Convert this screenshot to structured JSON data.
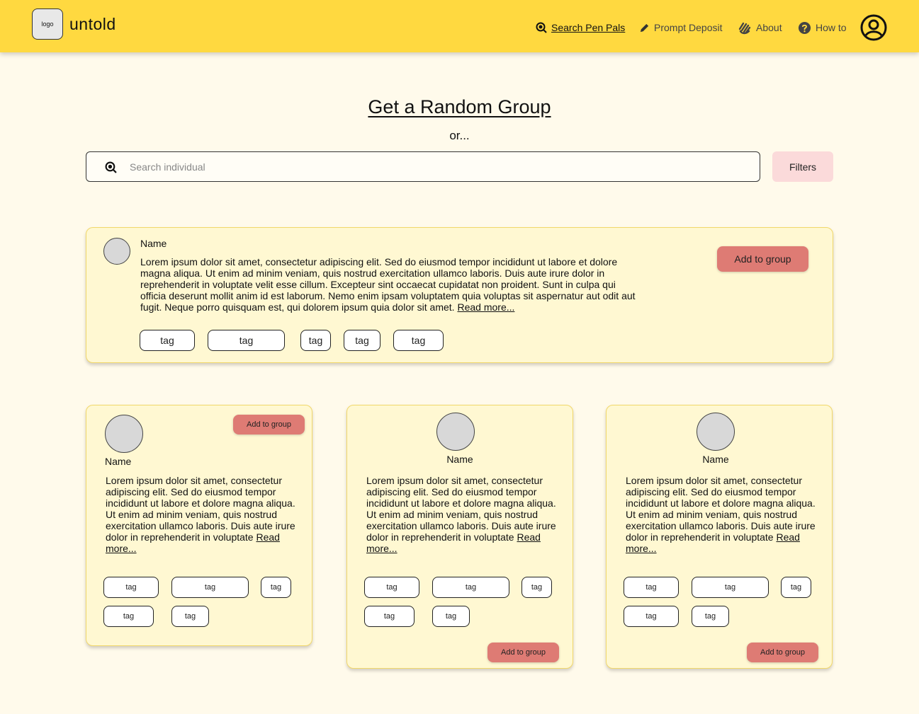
{
  "header": {
    "logo_text": "logo",
    "brand": "untold",
    "nav": [
      {
        "label": "Search Pen Pals",
        "icon": "search-icon"
      },
      {
        "label": "Prompt Deposit",
        "icon": "pencil-icon"
      },
      {
        "label": "About",
        "icon": "wave-hand-icon"
      },
      {
        "label": "How to",
        "icon": "help-circle-icon"
      }
    ]
  },
  "hero": {
    "title": "Get a Random Group",
    "or": "or...",
    "search_placeholder": "Search individual",
    "filters": "Filters"
  },
  "featured": {
    "name": "Name",
    "bio": "Lorem ipsum dolor sit amet, consectetur adipiscing elit. Sed do eiusmod tempor incididunt ut labore et dolore magna aliqua. Ut enim ad minim veniam, quis nostrud exercitation ullamco laboris. Duis aute irure dolor in reprehenderit in voluptate velit esse cillum. Excepteur sint occaecat cupidatat non proident. Sunt in culpa qui officia deserunt mollit anim id est laborum. Nemo enim ipsam voluptatem quia voluptas sit aspernatur aut odit aut fugit. Neque porro quisquam est, qui dolorem ipsum quia dolor sit amet.",
    "read_more": "Read more...",
    "add_label": "Add to group",
    "tags": [
      "tag",
      "tag",
      "tag",
      "tag",
      "tag"
    ]
  },
  "cards": [
    {
      "name": "Name",
      "bio": "Lorem ipsum dolor sit amet, consectetur adipiscing elit. Sed do eiusmod tempor incididunt ut labore et dolore magna aliqua. Ut enim ad minim veniam, quis nostrud exercitation ullamco laboris. Duis aute irure dolor in reprehenderit in voluptate",
      "read_more": "Read more...",
      "add_label": "Add to group",
      "tags": [
        "tag",
        "tag",
        "tag",
        "tag",
        "tag"
      ]
    },
    {
      "name": "Name",
      "bio": "Lorem ipsum dolor sit amet, consectetur adipiscing elit. Sed do eiusmod tempor incididunt ut labore et dolore magna aliqua. Ut enim ad minim veniam, quis nostrud exercitation ullamco laboris. Duis aute irure dolor in reprehenderit in voluptate",
      "read_more": "Read more...",
      "add_label": "Add to group",
      "tags": [
        "tag",
        "tag",
        "tag",
        "tag",
        "tag"
      ]
    },
    {
      "name": "Name",
      "bio": "Lorem ipsum dolor sit amet, consectetur adipiscing elit. Sed do eiusmod tempor incididunt ut labore et dolore magna aliqua. Ut enim ad minim veniam, quis nostrud exercitation ullamco laboris. Duis aute irure dolor in reprehenderit in voluptate",
      "read_more": "Read more...",
      "add_label": "Add to group",
      "tags": [
        "tag",
        "tag",
        "tag",
        "tag",
        "tag"
      ]
    }
  ],
  "colors": {
    "header_bg": "#ffd940",
    "page_bg": "#fffaeb",
    "card_bg": "#fff8d2",
    "accent_button": "#de7b74",
    "filters_bg": "#fbdada"
  }
}
